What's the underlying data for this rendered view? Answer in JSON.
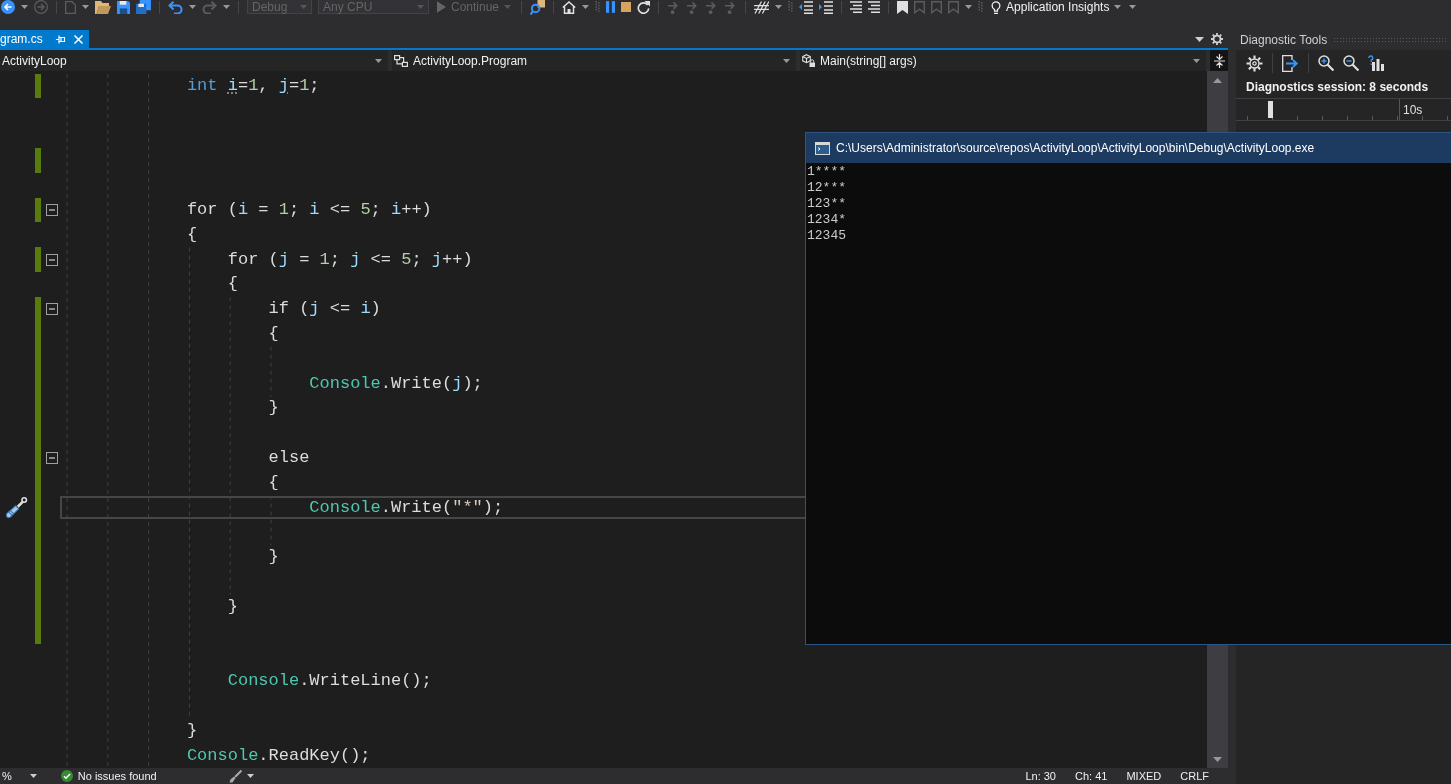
{
  "toolbar": [
    {
      "kind": "dropdown",
      "label": "Debug",
      "disabled": true
    },
    {
      "kind": "dropdown",
      "label": "Any CPU",
      "disabled": true
    },
    {
      "kind": "button",
      "label": "Continue",
      "disabled": true
    },
    {
      "kind": "button",
      "label": "Application Insights",
      "disabled": false
    }
  ],
  "document_tabs": [
    {
      "label": "gram.cs",
      "selected": true
    }
  ],
  "navigation_bar": {
    "project": "ActivityLoop",
    "type": "ActivityLoop.Program",
    "member": "Main(string[] args)"
  },
  "editor": {
    "lines": [
      {
        "tokens": [
          {
            "text": "            int ",
            "kind": "keyword"
          },
          {
            "text": "i",
            "kind": "hint"
          },
          {
            "text": "=",
            "kind": "plain"
          },
          {
            "text": "1",
            "kind": "number"
          },
          {
            "text": ", ",
            "kind": "plain"
          },
          {
            "text": "j",
            "kind": "hint"
          },
          {
            "text": "=",
            "kind": "plain"
          },
          {
            "text": "1",
            "kind": "number"
          },
          {
            "text": ";",
            "kind": "plain"
          }
        ],
        "changed": true,
        "collapsible": false,
        "current": false
      },
      {
        "changed": false,
        "collapsible": false,
        "current": false
      },
      {
        "changed": false,
        "collapsible": false,
        "current": false
      },
      {
        "changed": true,
        "collapsible": false,
        "current": false
      },
      {
        "changed": false,
        "collapsible": false,
        "current": false
      },
      {
        "tokens": [
          {
            "text": "            for (",
            "kind": "plain"
          },
          {
            "text": "i",
            "kind": "variable"
          },
          {
            "text": " = ",
            "kind": "plain"
          },
          {
            "text": "1",
            "kind": "number"
          },
          {
            "text": "; ",
            "kind": "plain"
          },
          {
            "text": "i",
            "kind": "variable"
          },
          {
            "text": " <= ",
            "kind": "plain"
          },
          {
            "text": "5",
            "kind": "number"
          },
          {
            "text": "; ",
            "kind": "plain"
          },
          {
            "text": "i",
            "kind": "variable"
          },
          {
            "text": "++)",
            "kind": "plain"
          }
        ],
        "changed": true,
        "collapsible": true,
        "current": false
      },
      {
        "tokens": [
          {
            "text": "            {",
            "kind": "plain"
          }
        ],
        "changed": false,
        "collapsible": false,
        "current": false
      },
      {
        "tokens": [
          {
            "text": "                for (",
            "kind": "plain"
          },
          {
            "text": "j",
            "kind": "variable"
          },
          {
            "text": " = ",
            "kind": "plain"
          },
          {
            "text": "1",
            "kind": "number"
          },
          {
            "text": "; ",
            "kind": "plain"
          },
          {
            "text": "j",
            "kind": "variable"
          },
          {
            "text": " <= ",
            "kind": "plain"
          },
          {
            "text": "5",
            "kind": "number"
          },
          {
            "text": "; ",
            "kind": "plain"
          },
          {
            "text": "j",
            "kind": "variable"
          },
          {
            "text": "++)",
            "kind": "plain"
          }
        ],
        "changed": true,
        "collapsible": true,
        "current": false
      },
      {
        "tokens": [
          {
            "text": "                {",
            "kind": "plain"
          }
        ],
        "changed": false,
        "collapsible": false,
        "current": false
      },
      {
        "tokens": [
          {
            "text": "                    if (",
            "kind": "plain"
          },
          {
            "text": "j",
            "kind": "variable"
          },
          {
            "text": " <= ",
            "kind": "plain"
          },
          {
            "text": "i",
            "kind": "variable"
          },
          {
            "text": ")",
            "kind": "plain"
          }
        ],
        "changed": true,
        "collapsible": true,
        "current": false
      },
      {
        "tokens": [
          {
            "text": "                    {",
            "kind": "plain"
          }
        ],
        "changed": true,
        "collapsible": false,
        "current": false
      },
      {
        "changed": true,
        "collapsible": false,
        "current": false
      },
      {
        "tokens": [
          {
            "text": "                        Console",
            "kind": "type"
          },
          {
            "text": ".Write(",
            "kind": "plain"
          },
          {
            "text": "j",
            "kind": "variable"
          },
          {
            "text": ");",
            "kind": "plain"
          }
        ],
        "changed": true,
        "collapsible": false,
        "current": false
      },
      {
        "tokens": [
          {
            "text": "                    }",
            "kind": "plain"
          }
        ],
        "changed": true,
        "collapsible": false,
        "current": false
      },
      {
        "changed": true,
        "collapsible": false,
        "current": false
      },
      {
        "tokens": [
          {
            "text": "                    else",
            "kind": "plain"
          }
        ],
        "changed": true,
        "collapsible": true,
        "current": false
      },
      {
        "tokens": [
          {
            "text": "                    {",
            "kind": "plain"
          }
        ],
        "changed": true,
        "collapsible": false,
        "current": false
      },
      {
        "tokens": [
          {
            "text": "                        Console",
            "kind": "type"
          },
          {
            "text": ".Write(",
            "kind": "plain"
          },
          {
            "text": "\"*\"",
            "kind": "string"
          },
          {
            "text": ");",
            "kind": "plain"
          }
        ],
        "changed": true,
        "collapsible": false,
        "current": true
      },
      {
        "changed": true,
        "collapsible": false,
        "current": false
      },
      {
        "tokens": [
          {
            "text": "                    }",
            "kind": "plain"
          }
        ],
        "changed": true,
        "collapsible": false,
        "current": false
      },
      {
        "changed": true,
        "collapsible": false,
        "current": false
      },
      {
        "tokens": [
          {
            "text": "                }",
            "kind": "plain"
          }
        ],
        "changed": true,
        "collapsible": false,
        "current": false
      },
      {
        "changed": true,
        "collapsible": false,
        "current": false
      },
      {
        "changed": false,
        "collapsible": false,
        "current": false
      },
      {
        "tokens": [
          {
            "text": "                Console",
            "kind": "type"
          },
          {
            "text": ".WriteLine();",
            "kind": "plain"
          }
        ],
        "changed": false,
        "collapsible": false,
        "current": false
      },
      {
        "changed": false,
        "collapsible": false,
        "current": false
      },
      {
        "tokens": [
          {
            "text": "            }",
            "kind": "plain"
          }
        ],
        "changed": false,
        "collapsible": false,
        "current": false
      },
      {
        "tokens": [
          {
            "text": "            Console",
            "kind": "type"
          },
          {
            "text": ".ReadKey();",
            "kind": "plain"
          }
        ],
        "changed": false,
        "collapsible": false,
        "current": false
      }
    ]
  },
  "status_bar": {
    "zoom": "%",
    "issues": "No issues found",
    "line": "Ln: 30",
    "column": "Ch: 41",
    "mode": "MIXED",
    "line_endings": "CRLF"
  },
  "diagnostic_tools": {
    "title": "Diagnostic Tools",
    "session": "Diagnostics session: 8 seconds",
    "timeline_label": "10s"
  },
  "console_window": {
    "title": "C:\\Users\\Administrator\\source\\repos\\ActivityLoop\\ActivityLoop\\bin\\Debug\\ActivityLoop.exe",
    "output": [
      "1****",
      "12***",
      "123**",
      "1234*",
      "12345"
    ]
  }
}
